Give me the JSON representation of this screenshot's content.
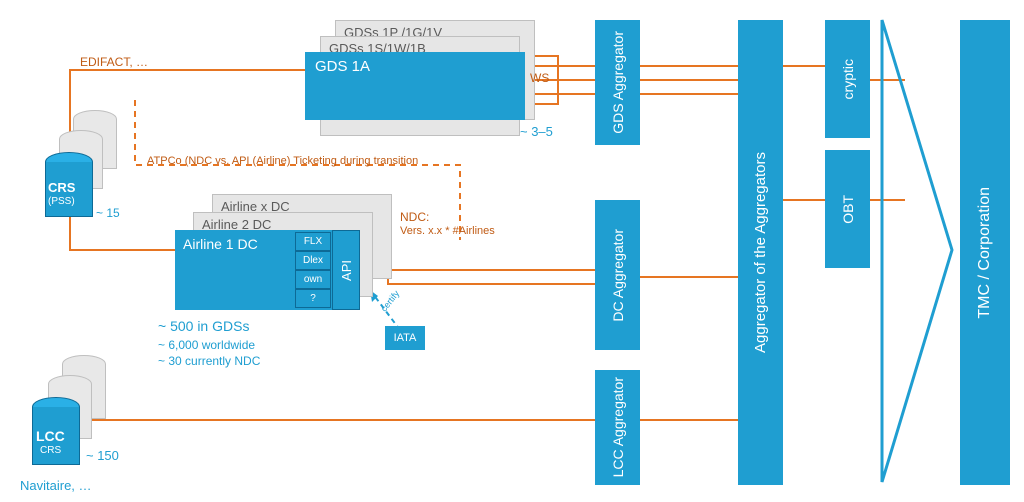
{
  "edifact_label": "EDIFACT, …",
  "crs": {
    "title": "CRS",
    "sub": "(PSS)",
    "count": "~ 15"
  },
  "gds_stack": {
    "back2": "GDSs 1P /1G/1V",
    "back1": "GDSs 1S/1W/1B",
    "front": "GDS 1A",
    "count": "~ 3–5",
    "ws": "WS"
  },
  "atpco_note": "ATPCo (NDC vs. API (Airline) Ticketing during transition",
  "airline_stack": {
    "back2": "Airline x DC",
    "back1": "Airline 2 DC",
    "front": "Airline 1 DC"
  },
  "airline_api_box": "API",
  "airline_sub_boxes": {
    "flx": "FLX",
    "dlex": "Dlex",
    "own": "own",
    "q": "?"
  },
  "ndc_label": {
    "line1": "NDC:",
    "line2": "Vers. x.x * #Airlines"
  },
  "iata_label": "IATA",
  "iata_arrow_label": "certify",
  "airline_stats": {
    "l1": "~ 500 in GDSs",
    "l2": "~ 6,000 worldwide",
    "l3": "~ 30 currently NDC"
  },
  "lcc": {
    "title": "LCC",
    "sub": "CRS",
    "count": "~ 150",
    "footer": "Navitaire, …"
  },
  "gds_aggregator": "GDS Aggregator",
  "dc_aggregator": "DC Aggregator",
  "lcc_aggregator": "LCC Aggregator",
  "agg_of_agg": "Aggregator of the Aggregators",
  "cryptic": "cryptic",
  "obt": "OBT",
  "tmc": "TMC / Corporation",
  "chart_data": {
    "type": "diagram",
    "flow": "airline-distribution-architecture",
    "sources": [
      {
        "name": "CRS (PSS)",
        "approx_count": 15,
        "protocol": "EDIFACT"
      },
      {
        "name": "GDS",
        "examples": [
          "1A",
          "1S",
          "1W",
          "1B",
          "1P",
          "1G",
          "1V"
        ],
        "approx_count_range": "3-5",
        "interface": "WS"
      },
      {
        "name": "Airline DC",
        "approx_in_gds": 500,
        "approx_worldwide": 6000,
        "approx_ndc": 30,
        "api_variants": [
          "FLX",
          "Dlex",
          "own",
          "?"
        ],
        "protocol": "NDC",
        "certified_by": "IATA"
      },
      {
        "name": "LCC CRS",
        "approx_count": 150,
        "example_platform": "Navitaire"
      }
    ],
    "aggregators_layer1": [
      "GDS Aggregator",
      "DC Aggregator",
      "LCC Aggregator"
    ],
    "aggregators_layer2": [
      "Aggregator of the Aggregators"
    ],
    "front_ends": [
      "cryptic",
      "OBT"
    ],
    "end_consumer": "TMC / Corporation"
  }
}
